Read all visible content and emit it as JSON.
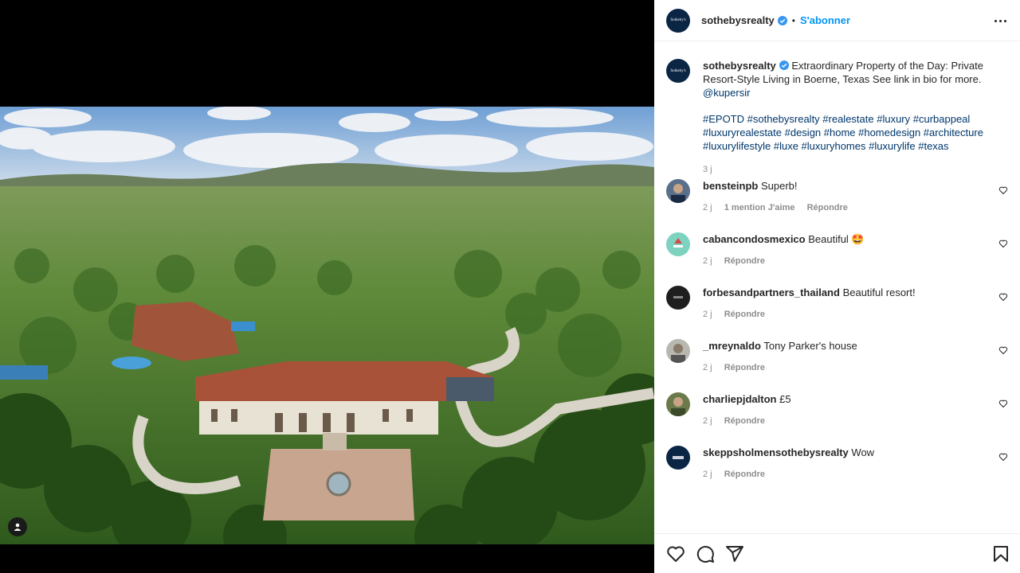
{
  "post": {
    "username": "sothebysrealty",
    "follow_label": "S'abonner",
    "avatar_text": "Sotheby's"
  },
  "caption": {
    "username": "sothebysrealty",
    "text": "Extraordinary Property of the Day: Private Resort-Style Living in Boerne, Texas See link in bio for more.",
    "mention": "@kupersir",
    "hashtags": "#EPOTD #sothebysrealty #realestate #luxury #curbappeal #luxuryrealestate #design #home #homedesign #architecture #luxurylifestyle #luxe #luxuryhomes #luxurylife #texas",
    "time": "3 j"
  },
  "comments": [
    {
      "username": "bensteinpb",
      "text": "Superb!",
      "time": "2 j",
      "likes": "1 mention J'aime",
      "reply": "Répondre"
    },
    {
      "username": "cabancondosmexico",
      "text": "Beautiful 🤩",
      "time": "2 j",
      "reply": "Répondre"
    },
    {
      "username": "forbesandpartners_thailand",
      "text": "Beautiful resort!",
      "time": "2 j",
      "reply": "Répondre"
    },
    {
      "username": "_mreynaldo",
      "text": "Tony Parker's house",
      "time": "2 j",
      "reply": "Répondre"
    },
    {
      "username": "charliepjdalton",
      "text": "£5",
      "time": "2 j",
      "reply": "Répondre"
    },
    {
      "username": "skeppsholmensothebysrealty",
      "text": "Wow",
      "time": "2 j",
      "reply": "Répondre"
    }
  ],
  "icons": {
    "like": "heart-icon",
    "comment": "comment-icon",
    "share": "share-icon",
    "save": "bookmark-icon",
    "more": "more-icon",
    "user_tag": "user-icon"
  },
  "colors": {
    "accent": "#0095f6",
    "link": "#00376b",
    "verified": "#3897f0",
    "muted": "#8e8e8e"
  }
}
